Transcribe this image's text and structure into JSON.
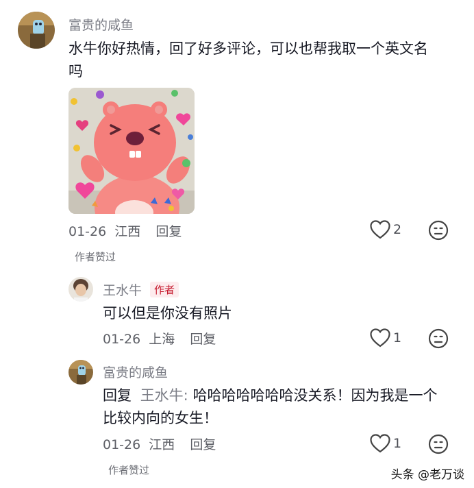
{
  "comment": {
    "username": "富贵的咸鱼",
    "text_line1": "水牛你好热情，回了好多评论，可以也帮我取一个英文名",
    "text_line2": "吗",
    "date": "01-26",
    "location": "江西",
    "reply_label": "回复",
    "like_count": "2",
    "author_liked": "作者赞过"
  },
  "replies": [
    {
      "username": "王水牛",
      "author_tag": "作者",
      "text": "可以但是你没有照片",
      "date": "01-26",
      "location": "上海",
      "reply_label": "回复",
      "like_count": "1"
    },
    {
      "username": "富贵的咸鱼",
      "reply_prefix": "回复",
      "reply_to": "王水牛:",
      "text_line1": "哈哈哈哈哈哈哈没关系！因为我是一个",
      "text_line2": "比较内向的女生！",
      "date": "01-26",
      "location": "江西",
      "reply_label": "回复",
      "like_count": "1",
      "author_liked": "作者赞过"
    }
  ],
  "watermark": "头条 @老万谈",
  "colors": {
    "author_tag": "#c5192d",
    "author_tag_bg": "#fdecee",
    "sticker_bg": "#ddd9cf",
    "sticker_character": "#f57e7b"
  }
}
